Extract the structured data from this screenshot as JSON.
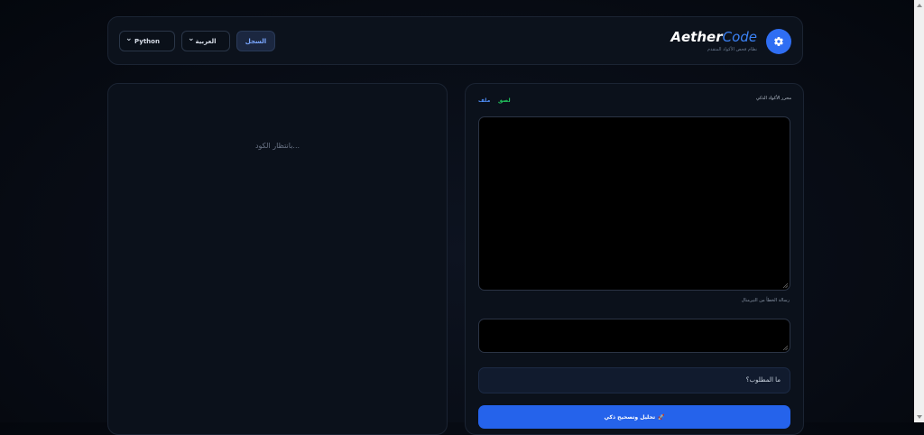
{
  "header": {
    "language_select": {
      "value": "Python"
    },
    "ui_language_select": {
      "value": "العربية"
    },
    "history_button": {
      "label": "السجل"
    },
    "brand": {
      "name_bold": "Aether",
      "name_light": "Code",
      "subtitle": "نظام فحص الأكواد المتقدم"
    },
    "settings_icon": "gear-icon"
  },
  "output_panel": {
    "placeholder": "بانتظار الكود..."
  },
  "editor_panel": {
    "title": "محرر الأكواد الذكي",
    "tabs": {
      "file": "ملف",
      "paste": "لصق"
    },
    "error_label": "رسالة الخطأ من التيرمنال",
    "prompt_placeholder": "ما المطلوب؟",
    "analyze_button": {
      "label": "تحليل وتصحيح ذكي",
      "icon": "rocket-icon"
    }
  },
  "colors": {
    "accent": "#2563eb",
    "file_tab": "#4f8ef7",
    "paste_tab": "#22c55e"
  }
}
